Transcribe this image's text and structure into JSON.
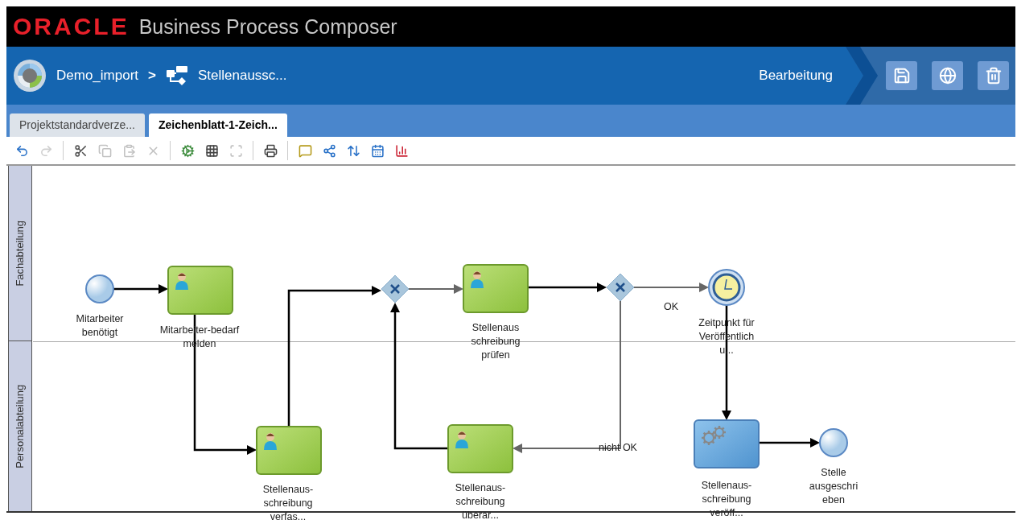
{
  "header": {
    "logo": "ORACLE",
    "title": "Business Process Composer"
  },
  "navbar": {
    "breadcrumb": [
      {
        "kind": "project",
        "label": "Demo_import"
      },
      {
        "kind": "process",
        "label": "Stellenaussc..."
      }
    ],
    "separator": ">",
    "mode": "Bearbeitung",
    "actions": [
      {
        "kind": "save"
      },
      {
        "kind": "publish"
      },
      {
        "kind": "delete"
      }
    ]
  },
  "tabs": [
    {
      "label": "Projektstandardverze...",
      "selected": false
    },
    {
      "label": "Zeichenblatt-1-Zeich...",
      "selected": true
    }
  ],
  "toolbar": [
    [
      {
        "kind": "undo",
        "disabled": false
      },
      {
        "kind": "redo",
        "disabled": true
      }
    ],
    [
      {
        "kind": "cut",
        "disabled": false
      },
      {
        "kind": "copy",
        "disabled": true
      },
      {
        "kind": "paste",
        "disabled": true
      },
      {
        "kind": "delete",
        "disabled": true
      }
    ],
    [
      {
        "kind": "validate",
        "disabled": false
      },
      {
        "kind": "grid",
        "disabled": false
      },
      {
        "kind": "fit",
        "disabled": true
      }
    ],
    [
      {
        "kind": "print",
        "disabled": false
      }
    ],
    [
      {
        "kind": "comment",
        "disabled": false
      },
      {
        "kind": "share",
        "disabled": false
      },
      {
        "kind": "align",
        "disabled": false
      },
      {
        "kind": "calendar",
        "disabled": false
      },
      {
        "kind": "chart",
        "disabled": false
      }
    ]
  ],
  "lanes": [
    {
      "name": "Fachabteilung"
    },
    {
      "name": "Personalabteilung"
    }
  ],
  "nodes": [
    {
      "kind": "start_event",
      "label": "Mitarbeiter\nbenötigt"
    },
    {
      "kind": "user_task",
      "label": "Mitarbeiter-bedarf\nmelden"
    },
    {
      "kind": "user_task",
      "label": "Stellenaus-\nschreibung\nverfas..."
    },
    {
      "kind": "gateway"
    },
    {
      "kind": "user_task",
      "label": "Stellenaus\nschreibung\nprüfen"
    },
    {
      "kind": "gateway"
    },
    {
      "kind": "timer_event",
      "label": "Zeitpunkt für\nVeröffentlich\nu..."
    },
    {
      "kind": "user_task",
      "label": "Stellenaus-\nschreibung\nüberar..."
    },
    {
      "kind": "service_task",
      "label": "Stellenaus-\nschreibung\nveröff..."
    },
    {
      "kind": "end_event",
      "label": "Stelle\nausgeschri\neben"
    }
  ],
  "flow_labels": [
    "OK",
    "nicht OK"
  ]
}
